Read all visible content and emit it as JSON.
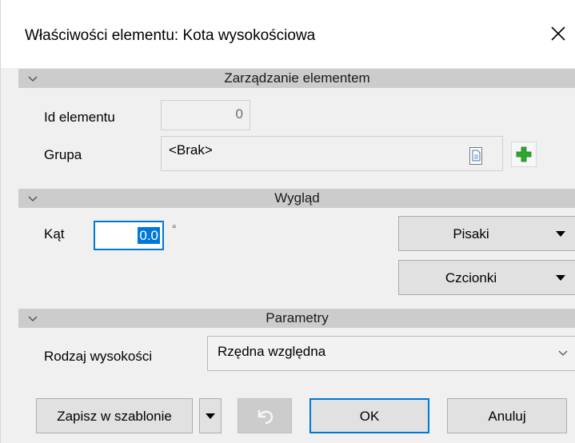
{
  "window": {
    "title": "Właściwości elementu: Kota wysokościowa",
    "close_icon": "close-icon"
  },
  "sections": {
    "management": {
      "label": "Zarządzanie elementem",
      "icon": "chevron-down-icon"
    },
    "appearance": {
      "label": "Wygląd",
      "icon": "chevron-down-icon"
    },
    "parameters": {
      "label": "Parametry",
      "icon": "chevron-down-icon"
    }
  },
  "management": {
    "id_label": "Id elementu",
    "id_value": "0",
    "group_label": "Grupa",
    "group_value": "<Brak>",
    "doc_icon": "document-icon",
    "add_icon": "plus-icon"
  },
  "appearance": {
    "angle_label": "Kąt",
    "angle_value": "0.0",
    "angle_unit": "°",
    "pens_label": "Pisaki",
    "fonts_label": "Czcionki"
  },
  "parameters": {
    "height_type_label": "Rodzaj wysokości",
    "height_type_value": "Rzędna względna"
  },
  "footer": {
    "save_template_label": "Zapisz w szablonie",
    "undo_icon": "undo-icon",
    "ok_label": "OK",
    "cancel_label": "Anuluj"
  },
  "colors": {
    "accent": "#0078d7",
    "section_header": "#cccccc",
    "plus_green": "#2ea82e"
  }
}
